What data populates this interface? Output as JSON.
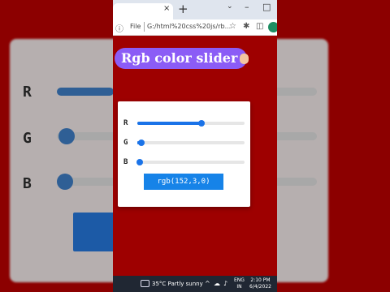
{
  "browser": {
    "tab_close": "×",
    "new_tab": "+",
    "chevron": "⌄",
    "minimize": "–",
    "maximize": "□",
    "address_scheme": "File",
    "address_url": "G:/html%20css%20js/rb...",
    "nav_back": "←",
    "nav_forward": "→",
    "nav_reload": "C",
    "addr_info": "ⓘ",
    "star": "☆",
    "extensions": "✱",
    "sidebar": "◫"
  },
  "app": {
    "title": "Rgb color slider",
    "background_color": "#9e0000",
    "sliders": [
      {
        "label": "R",
        "value": 152,
        "max": 255
      },
      {
        "label": "G",
        "value": 3,
        "max": 255
      },
      {
        "label": "B",
        "value": 0,
        "max": 255
      }
    ],
    "output_button": "rgb(152,3,0)",
    "accent": "#1a73e8",
    "button_color": "#1683e8",
    "title_pill_color": "#8b5cf6"
  },
  "taskbar": {
    "temperature": "35°C",
    "weather": "Partly sunny",
    "lang_top": "ENG",
    "lang_bottom": "IN",
    "time": "2:10 PM",
    "date": "6/4/2022"
  }
}
